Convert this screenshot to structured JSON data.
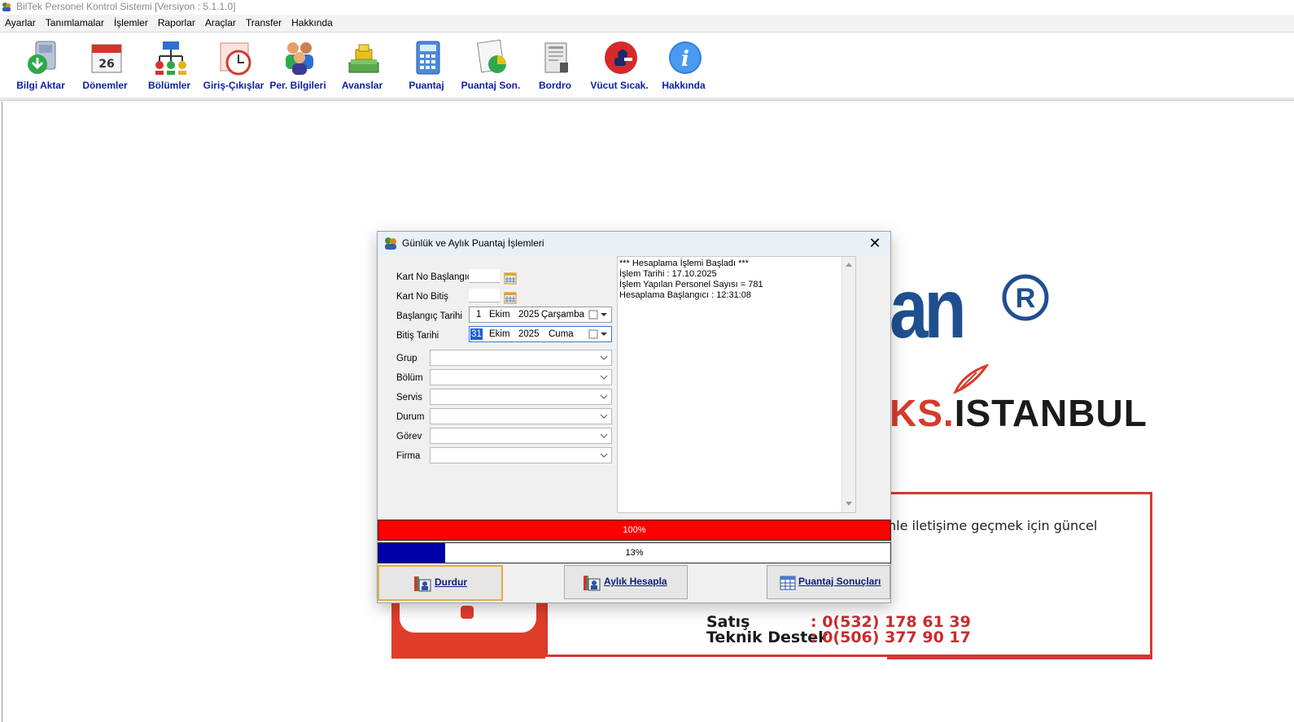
{
  "window": {
    "title": "BilTek Personel Kontrol Sistemi [Versiyon : 5.1.1.0]"
  },
  "menu": [
    {
      "label": "Ayarlar"
    },
    {
      "label": "Tanımlamalar"
    },
    {
      "label": "İşlemler"
    },
    {
      "label": "Raporlar"
    },
    {
      "label": "Araçlar"
    },
    {
      "label": "Transfer"
    },
    {
      "label": "Hakkında"
    }
  ],
  "toolbar": [
    {
      "label": "Bilgi Aktar",
      "icon": "data-transfer-icon"
    },
    {
      "label": "Dönemler",
      "icon": "calendar-icon"
    },
    {
      "label": "Bölümler",
      "icon": "org-chart-icon"
    },
    {
      "label": "Giriş-Çıkışlar",
      "icon": "clock-icon"
    },
    {
      "label": "Per. Bilgileri",
      "icon": "people-icon"
    },
    {
      "label": "Avanslar",
      "icon": "money-icon"
    },
    {
      "label": "Puantaj",
      "icon": "calculator-icon"
    },
    {
      "label": "Puantaj Son.",
      "icon": "report-chart-icon"
    },
    {
      "label": "Bordro",
      "icon": "payroll-icon"
    },
    {
      "label": "Vücut Sıcak.",
      "icon": "thermometer-icon"
    },
    {
      "label": "Hakkında",
      "icon": "info-icon"
    }
  ],
  "background": {
    "brand_partial": "an",
    "brand_city_ks": "KS.",
    "brand_city_rest": "ISTANBUL",
    "contact_partial": "nle iletişime geçmek için güncel",
    "sales_label": "Satış",
    "sales_value": ": 0(532) 178 61 39",
    "support_label": "Teknik Destek",
    "support_value": ": 0(506) 377 90 17"
  },
  "dialog": {
    "title": "Günlük ve Aylık Puantaj İşlemleri",
    "fields": {
      "kart_no_start_label": "Kart No Başlangıç",
      "kart_no_start_value": "",
      "kart_no_end_label": "Kart No Bitiş",
      "kart_no_end_value": "",
      "start_date_label": "Başlangıç Tarihi",
      "start_date_day": "1",
      "start_date_month": "Ekim",
      "start_date_year": "2025",
      "start_date_weekday": "Çarşamba",
      "end_date_label": "Bitiş Tarihi",
      "end_date_day": "31",
      "end_date_month": "Ekim",
      "end_date_year": "2025",
      "end_date_weekday": "Cuma"
    },
    "filters": [
      {
        "label": "Grup",
        "value": ""
      },
      {
        "label": "Bölüm",
        "value": ""
      },
      {
        "label": "Servis",
        "value": ""
      },
      {
        "label": "Durum",
        "value": ""
      },
      {
        "label": "Görev",
        "value": ""
      },
      {
        "label": "Firma",
        "value": ""
      }
    ],
    "log": [
      "*** Hesaplama İşlemi Başladı ***",
      "İşlem Tarihi : 17.10.2025",
      "İşlem Yapılan Personel Sayısı = 781",
      "Hesaplama Başlangıcı : 12:31:08"
    ],
    "progress1": {
      "text": "100%",
      "value": 1.0,
      "color": "#ff0000"
    },
    "progress2": {
      "text": "13%",
      "value": 0.13,
      "color": "#0000a8"
    },
    "buttons": {
      "stop": "Durdur",
      "monthly": "Aylık Hesapla",
      "results": "Puantaj Sonuçları"
    }
  }
}
